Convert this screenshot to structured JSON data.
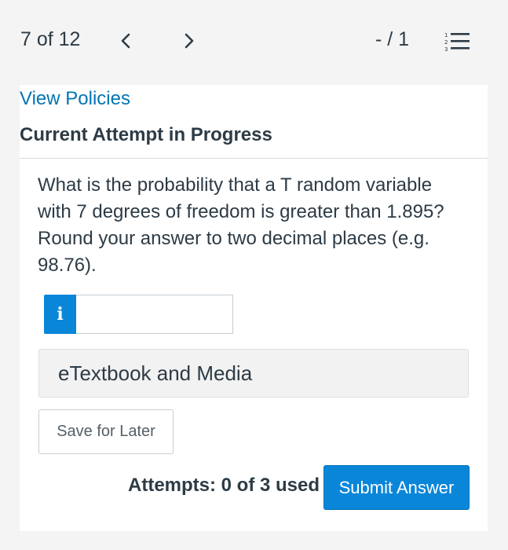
{
  "header": {
    "counter": "7 of 12",
    "score": "- / 1"
  },
  "panel": {
    "policies_link": "View Policies",
    "heading": "Current Attempt in Progress",
    "question": "What is the probability that a T random variable with 7 degrees of freedom is greater than 1.895? Round your answer to two decimal places (e.g. 98.76).",
    "info_badge": "i",
    "answer_value": "",
    "etextbook_label": "eTextbook and Media",
    "save_label": "Save for Later",
    "attempts_text": "Attempts: 0 of 3 used",
    "submit_label": "Submit Answer"
  },
  "icons": {
    "prev": "chevron-left-icon",
    "next": "chevron-right-icon",
    "list": "numbered-list-icon"
  },
  "colors": {
    "accent": "#0a86d9",
    "link": "#0374b5",
    "text": "#2d3b45"
  }
}
